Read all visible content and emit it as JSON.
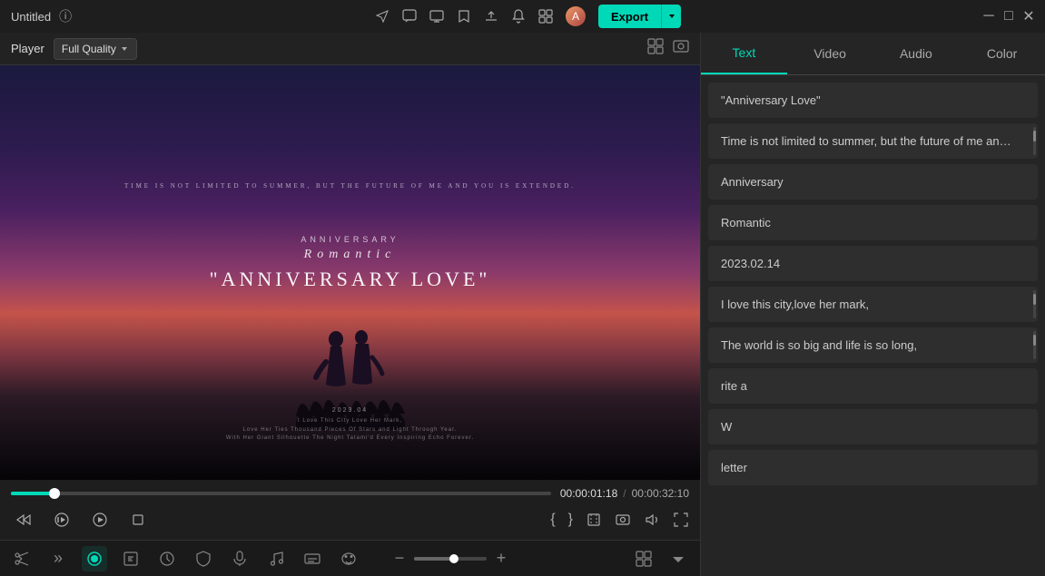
{
  "titleBar": {
    "title": "Untitled",
    "exportLabel": "Export",
    "icons": [
      "send",
      "chat",
      "display",
      "bookmark",
      "upload",
      "bell",
      "grid",
      "avatar"
    ]
  },
  "playerBar": {
    "playerLabel": "Player",
    "qualityLabel": "Full Quality",
    "gridIcon": "grid",
    "imageIcon": "image"
  },
  "videoPreview": {
    "subtitleTop": "Time is not limited to summer, but the future of me and you is extended.",
    "anniversaryLabel": "Anniversary",
    "romanticLabel": "Romantic",
    "mainTitle": "\"Anniversary Love\"",
    "dateLabel": "2023.04",
    "line1": "I Love This City Love Her Mark,",
    "line2": "Love Her Ties Thousand Pieces Of Stars and Light Through Year.",
    "line3": "With Her Giant Silhouette The Night Tatami'd Every Inspiring Echo Forever."
  },
  "transport": {
    "currentTime": "00:00:01:18",
    "totalTime": "00:00:32:10",
    "divider": "/"
  },
  "bottomToolbar": {
    "icons": [
      "scissors",
      "fast-forward",
      "slow",
      "shield",
      "mic",
      "music-note",
      "subtitle",
      "mask",
      "zoom-out",
      "zoom-in",
      "grid-view",
      "chevron-down"
    ]
  },
  "rightPanel": {
    "tabs": [
      {
        "id": "text",
        "label": "Text",
        "active": true
      },
      {
        "id": "video",
        "label": "Video",
        "active": false
      },
      {
        "id": "audio",
        "label": "Audio",
        "active": false
      },
      {
        "id": "color",
        "label": "Color",
        "active": false
      }
    ],
    "textItems": [
      {
        "id": 1,
        "content": "\"Anniversary Love\"",
        "hasScroll": false
      },
      {
        "id": 2,
        "content": "Time is not limited to summer, but the future of me and you",
        "hasScroll": true
      },
      {
        "id": 3,
        "content": "Anniversary",
        "hasScroll": false
      },
      {
        "id": 4,
        "content": "Romantic",
        "hasScroll": false
      },
      {
        "id": 5,
        "content": "2023.02.14",
        "hasScroll": false
      },
      {
        "id": 6,
        "content": "I love this city,love her mark,",
        "hasScroll": true
      },
      {
        "id": 7,
        "content": "The world is so big and life is so long,",
        "hasScroll": true
      },
      {
        "id": 8,
        "content": "rite a",
        "hasScroll": false
      },
      {
        "id": 9,
        "content": "W",
        "hasScroll": false
      },
      {
        "id": 10,
        "content": "letter",
        "hasScroll": false
      }
    ]
  }
}
